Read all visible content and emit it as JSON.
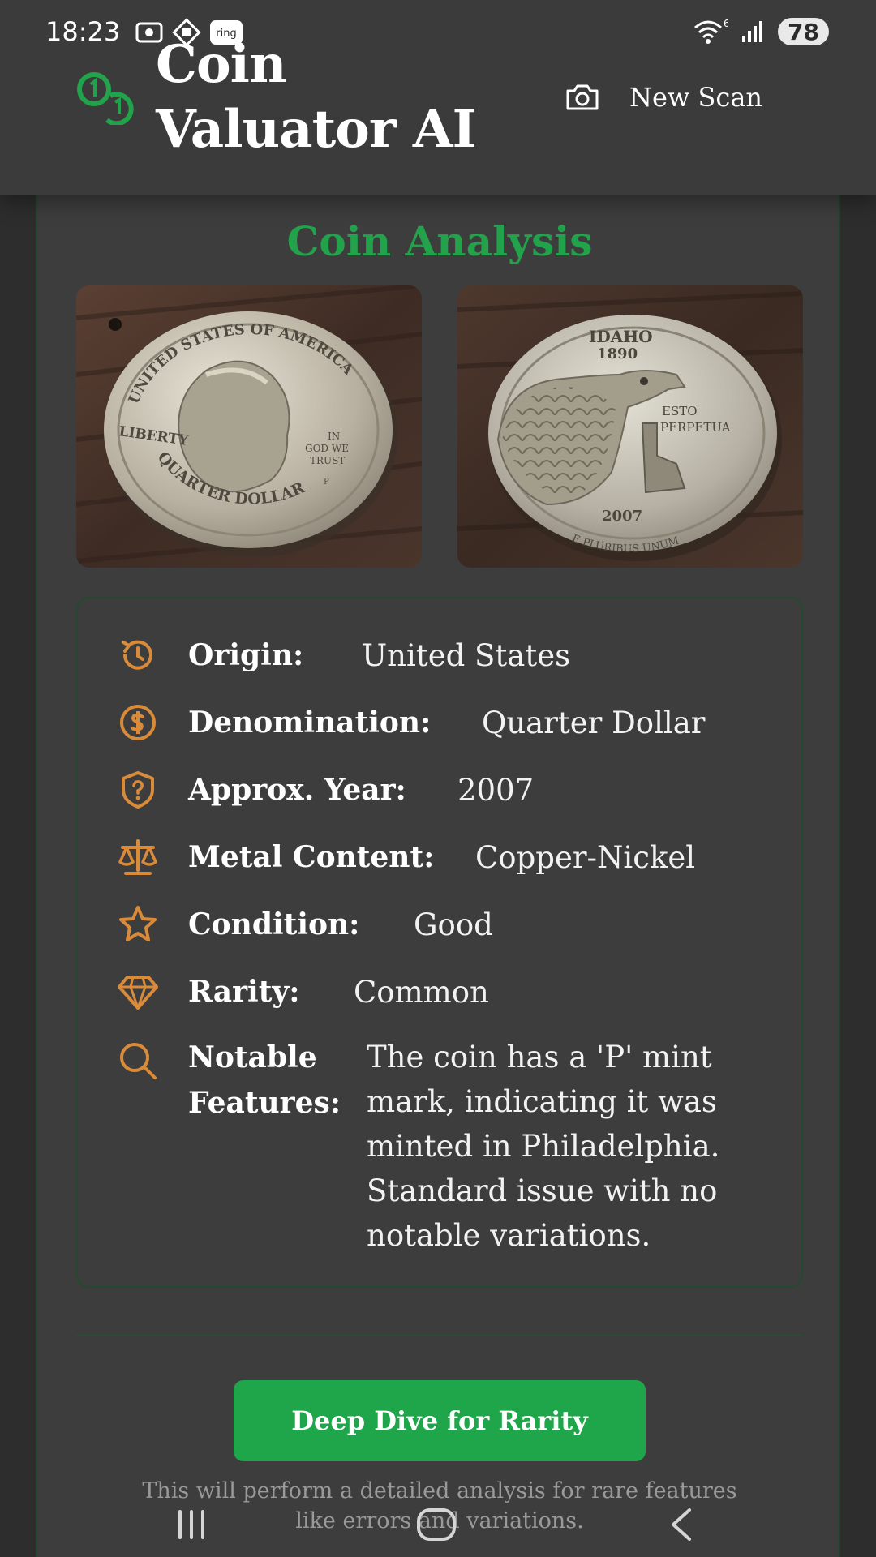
{
  "status_bar": {
    "time": "18:23",
    "battery": "78"
  },
  "header": {
    "title": "Coin Valuator AI",
    "new_scan_label": "New Scan",
    "accent": "#22a24a"
  },
  "analysis": {
    "title": "Coin Analysis",
    "details": [
      {
        "icon": "history-icon",
        "label": "Origin:",
        "value": "United States"
      },
      {
        "icon": "dollar-circle-icon",
        "label": "Denomination:",
        "value": "Quarter Dollar"
      },
      {
        "icon": "shield-question-icon",
        "label": "Approx. Year:",
        "value": "2007"
      },
      {
        "icon": "scale-icon",
        "label": "Metal Content:",
        "value": "Copper-Nickel"
      },
      {
        "icon": "star-icon",
        "label": "Condition:",
        "value": "Good"
      },
      {
        "icon": "gem-icon",
        "label": "Rarity:",
        "value": "Common"
      }
    ],
    "notable": {
      "icon": "search-icon",
      "label_line1": "Notable",
      "label_line2": "Features:",
      "lines": [
        "The coin has a 'P' mint",
        "mark, indicating it was",
        "minted in Philadelphia.",
        "Standard issue with no",
        "notable variations."
      ]
    },
    "deep_dive_label": "Deep Dive for Rarity",
    "helper_line1": "This will perform a detailed analysis for rare features",
    "helper_line2": "like errors and variations."
  },
  "coin_front_text": {
    "top": "UNITED STATES OF AMERICA",
    "left": "LIBERTY",
    "right_1": "IN",
    "right_2": "GOD WE",
    "right_3": "TRUST",
    "mint": "P",
    "bottom": "QUARTER DOLLAR"
  },
  "coin_back_text": {
    "state": "IDAHO",
    "statehood": "1890",
    "motto_1": "ESTO",
    "motto_2": "PERPETUA",
    "year": "2007",
    "bottom": "E PLURIBUS UNUM"
  },
  "colors": {
    "icon_orange": "#d98b3a",
    "button_green": "#1fa64a",
    "card_bg": "#3d3d3d"
  }
}
